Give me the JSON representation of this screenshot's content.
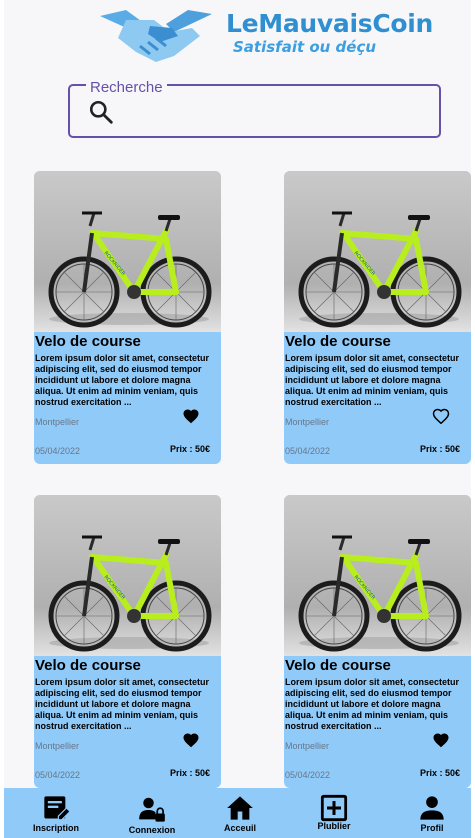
{
  "header": {
    "brand_title": "LeMauvaisCoin",
    "brand_subtitle": "Satisfait ou déçu"
  },
  "search": {
    "label": "Recherche",
    "value": ""
  },
  "listings": [
    {
      "title": "Velo de course",
      "description": "Lorem ipsum dolor sit amet, consectetur adipiscing elit, sed do eiusmod tempor incididunt ut labore et dolore magna aliqua. Ut enim ad minim veniam, quis nostrud exercitation  ...",
      "city": "Montpellier",
      "date": "05/04/2022",
      "price": "Prix : 50€",
      "favorite": true
    },
    {
      "title": "Velo de course",
      "description": "Lorem ipsum dolor sit amet, consectetur adipiscing elit, sed do eiusmod tempor incididunt ut labore et dolore magna aliqua. Ut enim ad minim veniam, quis nostrud exercitation  ...",
      "city": "Montpellier",
      "date": "05/04/2022",
      "price": "Prix : 50€",
      "favorite": false
    },
    {
      "title": "Velo de course",
      "description": "Lorem ipsum dolor sit amet, consectetur adipiscing elit, sed do eiusmod tempor incididunt ut labore et dolore magna aliqua. Ut enim ad minim veniam, quis nostrud exercitation  ...",
      "city": "Montpellier",
      "date": "05/04/2022",
      "price": "Prix : 50€",
      "favorite": true
    },
    {
      "title": "Velo de course",
      "description": "Lorem ipsum dolor sit amet, consectetur adipiscing elit, sed do eiusmod tempor incididunt ut labore et dolore magna aliqua. Ut enim ad minim veniam, quis nostrud exercitation  ...",
      "city": "Montpellier",
      "date": "05/04/2022",
      "price": "Prix : 50€",
      "favorite": true
    }
  ],
  "nav": [
    {
      "label": "Inscription",
      "icon": "register-form-icon"
    },
    {
      "label": "Connexion",
      "icon": "user-lock-icon"
    },
    {
      "label": "Acceuil",
      "icon": "home-icon"
    },
    {
      "label": "Plublier",
      "icon": "add-box-icon"
    },
    {
      "label": "Profil",
      "icon": "person-icon"
    }
  ],
  "colors": {
    "brand": "#2f8fd0",
    "card_bg": "#90caf9",
    "nav_bg": "#90caf9",
    "search_border": "#6651a8"
  }
}
